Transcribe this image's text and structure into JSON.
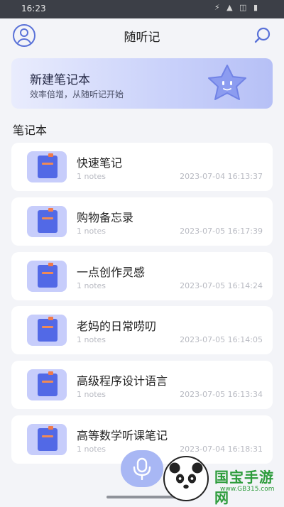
{
  "status": {
    "time": "16:23",
    "icons": "⚡ ▲ ◫ ▮"
  },
  "header": {
    "title": "随听记"
  },
  "banner": {
    "title": "新建笔记本",
    "subtitle": "效率倍增，从随听记开始"
  },
  "section": {
    "title": "笔记本"
  },
  "notes": [
    {
      "name": "快速笔记",
      "count": "1 notes",
      "date": "2023-07-04 16:13:37"
    },
    {
      "name": "购物备忘录",
      "count": "1 notes",
      "date": "2023-07-05 16:17:39"
    },
    {
      "name": "一点创作灵感",
      "count": "1 notes",
      "date": "2023-07-05 16:14:24"
    },
    {
      "name": "老妈的日常唠叨",
      "count": "1 notes",
      "date": "2023-07-05 16:14:05"
    },
    {
      "name": "高级程序设计语言",
      "count": "1 notes",
      "date": "2023-07-05 16:13:34"
    },
    {
      "name": "高等数学听课笔记",
      "count": "1 notes",
      "date": "2023-07-04 16:18:31"
    }
  ],
  "watermark": {
    "brand": "国宝手游网",
    "url": "www.GB315.com"
  },
  "colors": {
    "accent": "#5a72d8",
    "card": "#ffffff",
    "background": "#f3f4f8"
  }
}
